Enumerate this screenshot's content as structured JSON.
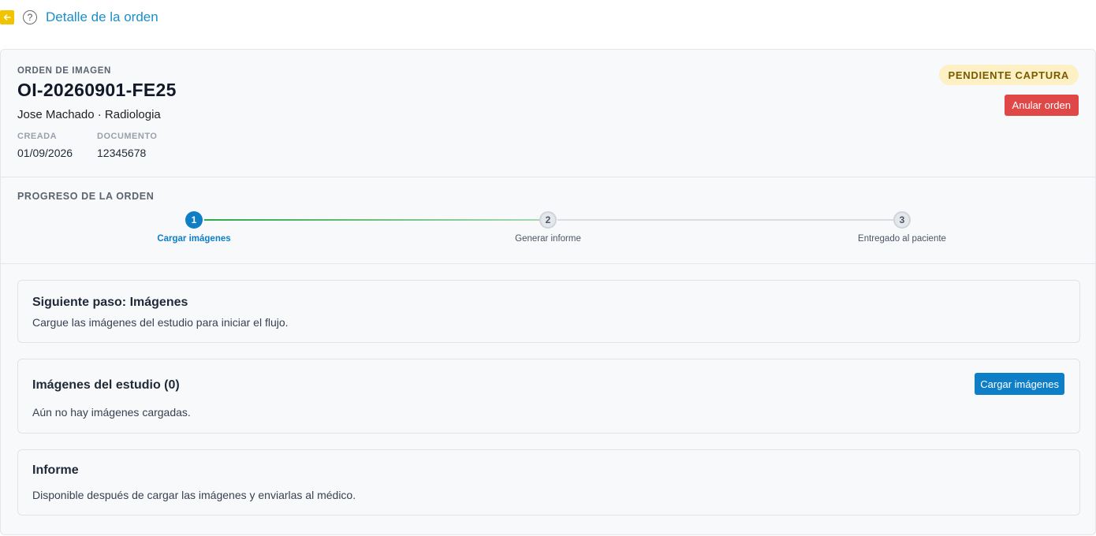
{
  "header": {
    "title": "Detalle de la orden",
    "back_icon": "arrow-left-icon",
    "help_glyph": "?"
  },
  "order": {
    "kicker": "ORDEN DE IMAGEN",
    "id": "OI-20260901-FE25",
    "patient_line": "Jose Machado · Radiologia",
    "meta": [
      {
        "label": "CREADA",
        "value": "01/09/2026"
      },
      {
        "label": "DOCUMENTO",
        "value": "12345678"
      }
    ],
    "status": "PENDIENTE CAPTURA",
    "cancel_label": "Anular orden"
  },
  "progress": {
    "title": "PROGRESO DE LA ORDEN",
    "steps": [
      {
        "number": "1",
        "label": "Cargar imágenes",
        "state": "active"
      },
      {
        "number": "2",
        "label": "Generar informe",
        "state": "pending"
      },
      {
        "number": "3",
        "label": "Entregado al paciente",
        "state": "pending"
      }
    ]
  },
  "next_step": {
    "title": "Siguiente paso: Imágenes",
    "text": "Cargue las imágenes del estudio para iniciar el flujo."
  },
  "images": {
    "title": "Imágenes del estudio (0)",
    "empty_text": "Aún no hay imágenes cargadas.",
    "upload_label": "Cargar imágenes"
  },
  "report": {
    "title": "Informe",
    "text": "Disponible después de cargar las imágenes y enviarlas al médico."
  },
  "colors": {
    "accent": "#0e7ec7",
    "danger": "#e04848",
    "badge_bg": "#fdf0c4",
    "badge_text": "#7a5a00",
    "progress_done": "#2ea84c",
    "back_button": "#f2c400"
  }
}
